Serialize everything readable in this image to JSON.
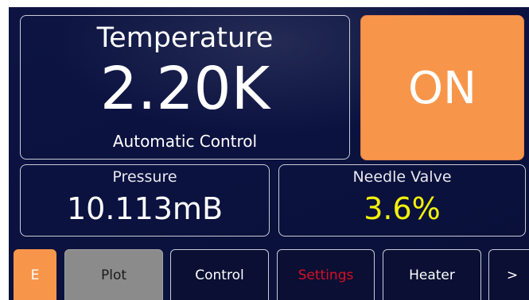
{
  "temperature": {
    "title": "Temperature",
    "value": "2.20K",
    "mode": "Automatic Control"
  },
  "heater_toggle": {
    "label": "ON",
    "color": "#f7964b"
  },
  "pressure": {
    "title": "Pressure",
    "value": "10.113mB"
  },
  "needle_valve": {
    "title": "Needle Valve",
    "value": "3.6%",
    "value_color": "#f2f20a"
  },
  "tabs": [
    {
      "label": "E"
    },
    {
      "label": "Plot"
    },
    {
      "label": "Control"
    },
    {
      "label": "Settings",
      "color": "#d90f24"
    },
    {
      "label": "Heater"
    },
    {
      "label": ">"
    }
  ]
}
